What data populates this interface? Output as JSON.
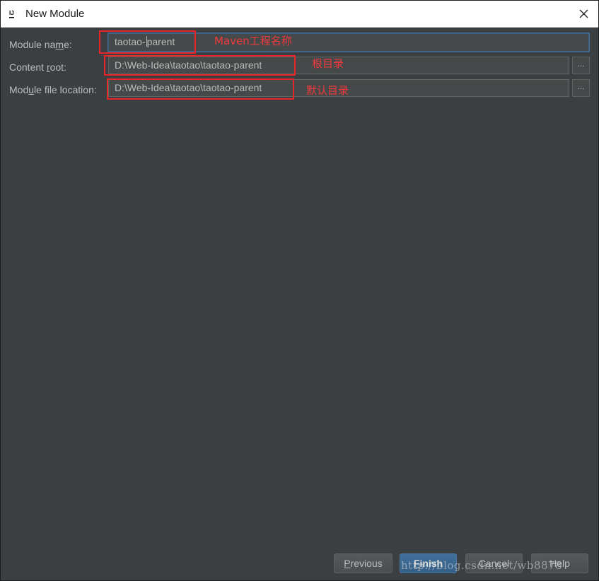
{
  "window": {
    "title": "New Module",
    "app_icon": "intellij-icon",
    "close_icon": "close-icon"
  },
  "form": {
    "module_name": {
      "label_before": "Module na",
      "label_mnemonic": "m",
      "label_after": "e:",
      "value_before_caret": "taotao-",
      "value_after_caret": "parent"
    },
    "content_root": {
      "label_before": "Content ",
      "label_mnemonic": "r",
      "label_after": "oot:",
      "value": "D:\\Web-Idea\\taotao\\taotao-parent",
      "browse": "..."
    },
    "module_file_location": {
      "label_before": "Mod",
      "label_mnemonic": "u",
      "label_after": "le file location:",
      "value": "D:\\Web-Idea\\taotao\\taotao-parent",
      "browse": "..."
    }
  },
  "annotations": {
    "module_name": "Maven工程名称",
    "content_root": "根目录",
    "module_file_location": "默认目录",
    "color": "#e8262a"
  },
  "buttons": {
    "previous": {
      "mnemonic": "P",
      "rest": "revious"
    },
    "finish": {
      "mnemonic": "F",
      "rest": "inish"
    },
    "cancel": "Cancel",
    "help": "Help"
  },
  "watermark": "http://blog.csdn.net/wb8878",
  "colors": {
    "background": "#3c3f41",
    "field_bg": "#45494a",
    "text": "#bbbbbb",
    "focus": "#466d94",
    "primary": "#365f86",
    "annotation": "#e8262a"
  }
}
